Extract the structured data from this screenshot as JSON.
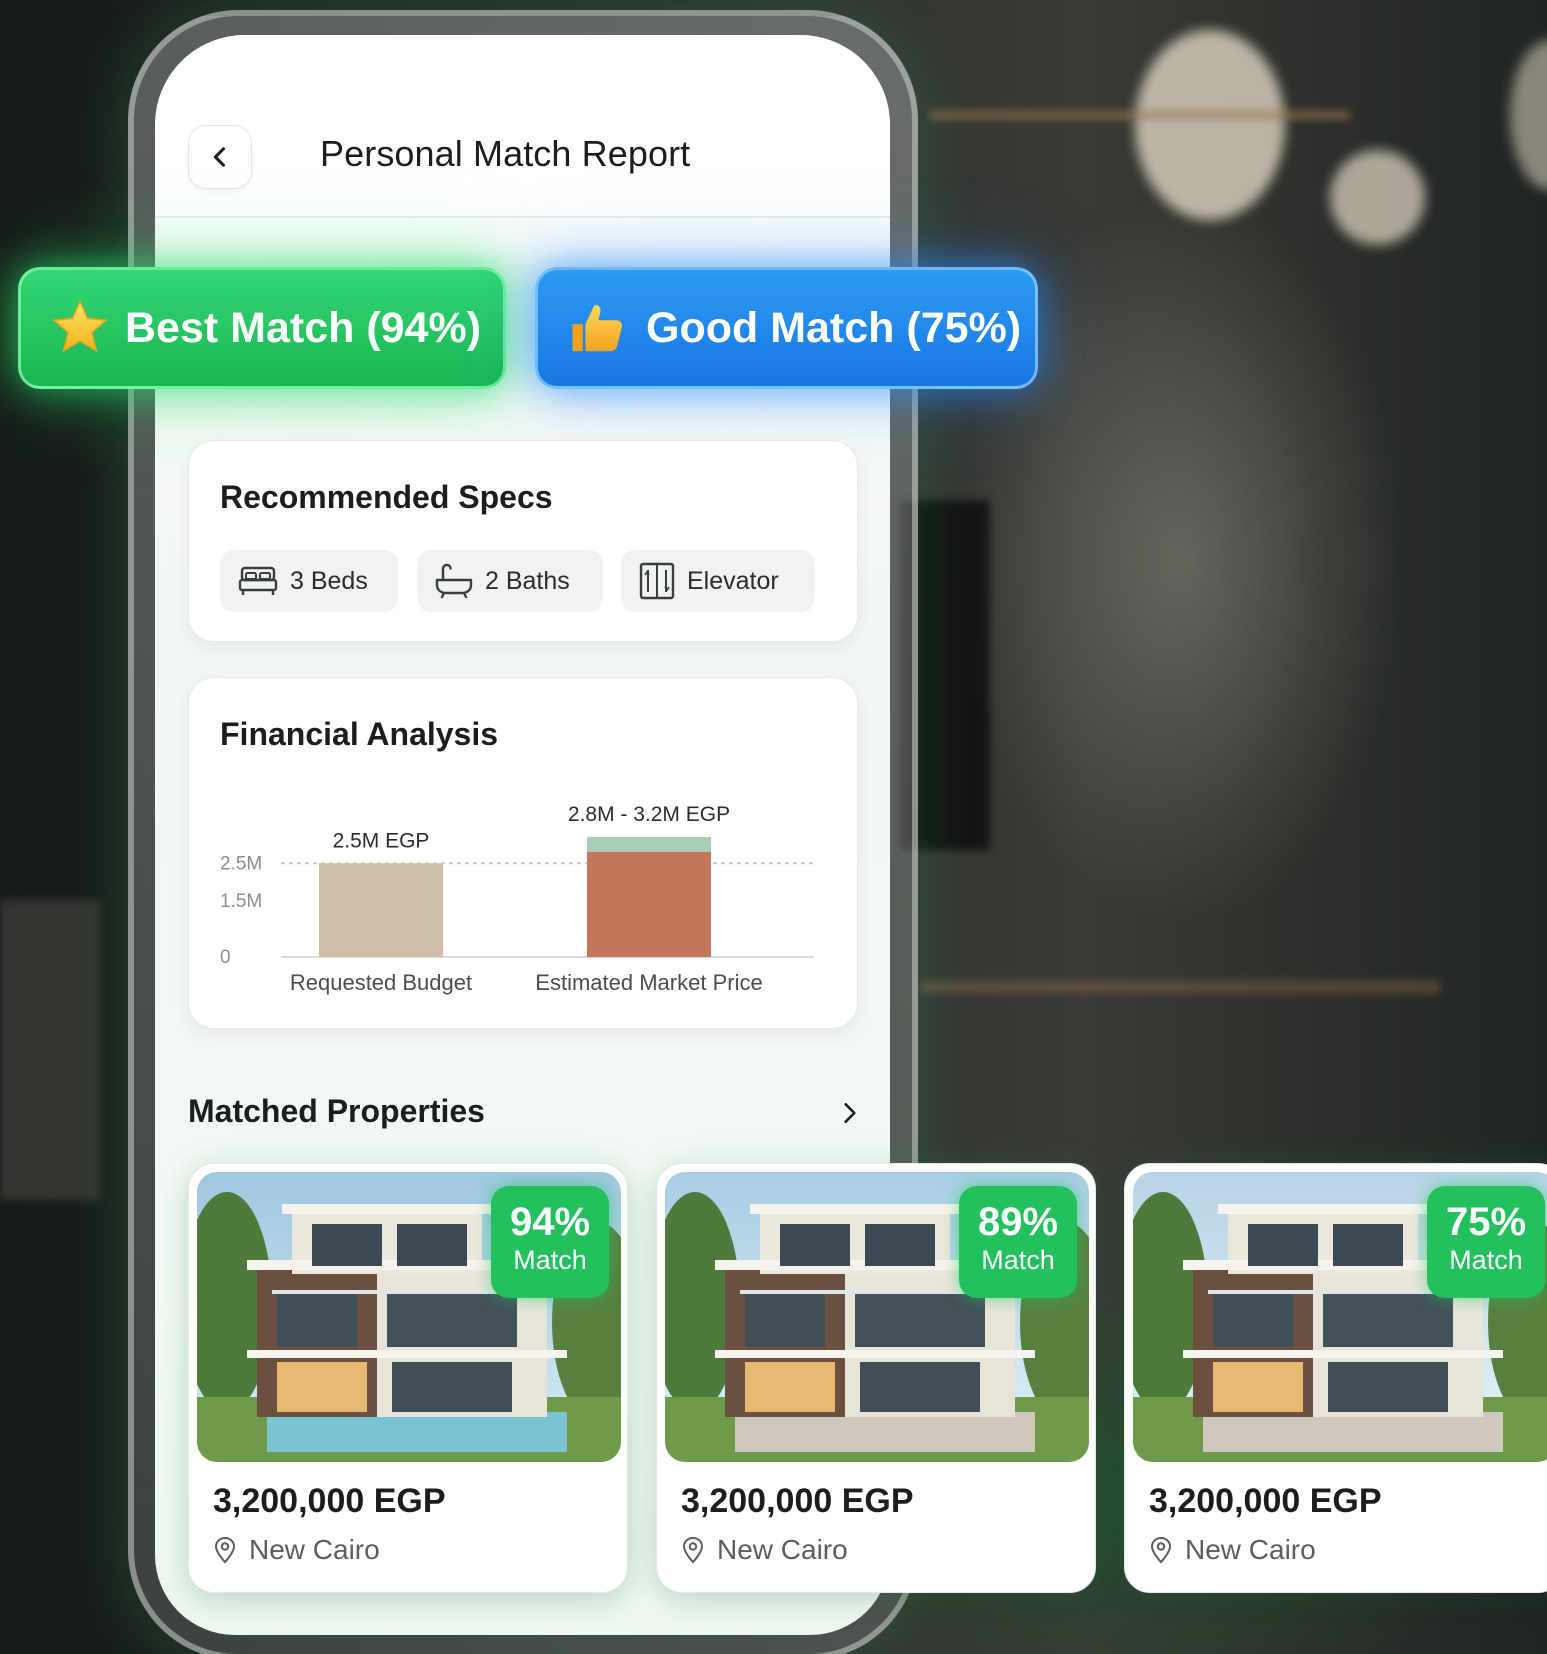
{
  "header": {
    "title": "Personal Match Report",
    "back_icon": "chevron-left-icon"
  },
  "badges": {
    "best": {
      "label": "Best Match (94%)",
      "icon": "star-icon",
      "color": "#22c15e"
    },
    "good": {
      "label": "Good Match (75%)",
      "icon": "thumbs-up-icon",
      "color": "#1f84ec"
    }
  },
  "recommended_specs": {
    "title": "Recommended Specs",
    "chips": [
      {
        "label": "3 Beds",
        "icon": "bed-icon"
      },
      {
        "label": "2 Baths",
        "icon": "bathtub-icon"
      },
      {
        "label": "Elevator",
        "icon": "elevator-icon"
      }
    ]
  },
  "financial_analysis": {
    "title": "Financial Analysis"
  },
  "chart_data": {
    "type": "bar",
    "categories": [
      "Requested Budget",
      "Estimated Market Price"
    ],
    "series": [
      {
        "values": [
          2.5,
          2.8
        ]
      },
      {
        "values": [
          0,
          0.4
        ]
      }
    ],
    "data_labels": [
      "2.5M EGP",
      "2.8M - 3.2M EGP"
    ],
    "y_ticks": [
      "0",
      "1.5M",
      "2.5M"
    ],
    "y_tick_values": [
      0,
      1.5,
      2.5
    ],
    "reference_line": 2.5,
    "ylim": [
      0,
      3.2
    ],
    "colors": [
      "#cfbea7",
      "#c4765a",
      "#a8ccb6"
    ],
    "grid": false
  },
  "matched_properties": {
    "title": "Matched Properties",
    "more_icon": "chevron-right-icon",
    "items": [
      {
        "match_pct": "94%",
        "match_word": "Match",
        "price": "3,200,000 EGP",
        "location": "New Cairo"
      },
      {
        "match_pct": "89%",
        "match_word": "Match",
        "price": "3,200,000 EGP",
        "location": "New Cairo"
      },
      {
        "match_pct": "75%",
        "match_word": "Match",
        "price": "3,200,000 EGP",
        "location": "New Cairo"
      }
    ]
  },
  "theme": {
    "accent_green": "#22c15e",
    "accent_blue": "#1f84ec",
    "text_dark": "#1b1e1c"
  }
}
